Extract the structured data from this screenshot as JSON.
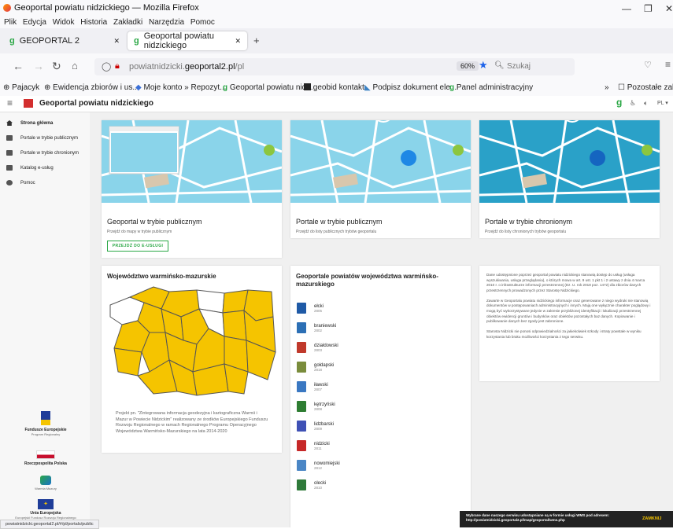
{
  "window": {
    "title": "Geoportal powiatu nidzickiego — Mozilla Firefox",
    "minimize": "—",
    "maximize": "❐",
    "close": "✕"
  },
  "menu": [
    "Plik",
    "Edycja",
    "Widok",
    "Historia",
    "Zakładki",
    "Narzędzia",
    "Pomoc"
  ],
  "tabs": [
    {
      "label": "GEOPORTAL 2",
      "close": "✕"
    },
    {
      "label": "Geoportal powiatu nidzickiego",
      "close": "✕"
    }
  ],
  "new_tab": "+",
  "url": {
    "prefix": "powiatnidzicki.",
    "domain": "geoportal2.pl",
    "path": "/pl"
  },
  "zoom": "60%",
  "search_placeholder": "Szukaj",
  "bookmarks": [
    "Pajacyk",
    "Ewidencja zbiorów i us...",
    "Moje konto » Repozyt...",
    "Geoportal powiatu nid...",
    "geobid kontakt",
    "Podpisz dokument ele...",
    "Panel administracyjny"
  ],
  "bookmarks_more": "»",
  "bookmarks_other": "Pozostałe zakładki",
  "app": {
    "title": "Geoportal powiatu nidzickiego",
    "lang": "PL"
  },
  "sidebar": [
    {
      "label": "Strona główna",
      "icon": "home-icon"
    },
    {
      "label": "Portale w trybie publicznym",
      "icon": "people-icon"
    },
    {
      "label": "Portale w trybie chronionym",
      "icon": "lock-icon"
    },
    {
      "label": "Katalog e-usług",
      "icon": "folder-icon"
    },
    {
      "label": "Pomoc",
      "icon": "help-icon"
    }
  ],
  "cards": [
    {
      "title": "Geoportal w trybie publicznym",
      "subtitle": "Przejdź do mapy w trybie publicznym",
      "button": "PRZEJDŹ DO E-USŁUGI"
    },
    {
      "title": "Portale w trybie publicznym",
      "subtitle": "Przejdź do listy publicznych trybów geoportalu"
    },
    {
      "title": "Portale w trybie chronionym",
      "subtitle": "Przejdź do listy chronionych trybów geoportalu"
    }
  ],
  "region": {
    "title": "Województwo warmińsko-mazurskie",
    "project_text": "Projekt pn. \"Zintegrowana informacja geodezyjna i kartograficzna Warmii i Mazur w Powiecie Nidzickim\" realizowany ze środków Europejskiego Funduszu Rozwoju Regionalnego w ramach Regionalnego Programu Operacyjnego Województwa Warmińsko-Mazurskiego na lata 2014-2020"
  },
  "counties": {
    "title": "Geoportale powiatów województwa warmińsko-mazurskiego",
    "items": [
      {
        "name": "ełcki",
        "code": "2805",
        "color": "#1f5aa6"
      },
      {
        "name": "braniewski",
        "code": "2802",
        "color": "#2c6fb5"
      },
      {
        "name": "działdowski",
        "code": "2803",
        "color": "#c0392b"
      },
      {
        "name": "gołdapski",
        "code": "2818",
        "color": "#7a8c3c"
      },
      {
        "name": "iławski",
        "code": "2807",
        "color": "#3a78c2"
      },
      {
        "name": "kętrzyński",
        "code": "2808",
        "color": "#2e7d32"
      },
      {
        "name": "lidzbarski",
        "code": "2809",
        "color": "#3f51b5"
      },
      {
        "name": "nidzicki",
        "code": "2811",
        "color": "#c62828"
      },
      {
        "name": "nowomiejski",
        "code": "2812",
        "color": "#4a86c5"
      },
      {
        "name": "olecki",
        "code": "2810",
        "color": "#2f7a3a"
      }
    ]
  },
  "disclaimer": [
    "Dane udostępnione poprzez geoportal powiatu nidzickiego stanowią dostęp do usług (usługa wyszukiwania, usługa przeglądania), o których mowa w art. 9 ust. 1 pkt 1 i 2 ustawy z dnia 4 marca 2010 r. o infrastrukturze informacji przestrzennej (Dz. U. rok 2018 poz. 1472) dla zbiorów danych przestrzennych prowadzonych przez Starostę Nidzickiego.",
    "Zawarte w Geoportalu powiatu nidzickiego informacje oraz generowane z niego wydruki nie stanowią dokumentów w postępowaniach administracyjnych i innych. Mają one wyłącznie charakter poglądowy i mogą być wykorzystywane jedynie w zakresie przybliżonej identyfikacji i lokalizacji przestrzennej obiektów ewidencji gruntów i budynków oraz obiektów pozostałych baz danych. Kopiowanie i publikowanie danych bez zgody jest zabronione.",
    "Starosta Nidzicki nie ponosi odpowiedzialności za jakiekolwiek szkody i straty powstałe w wyniku korzystania lub braku możliwości korzystania z tego serwisu."
  ],
  "footer_logos": [
    "Fundusze Europejskie",
    "Program Regionalny",
    "Rzeczpospolita Polska",
    "Warmia Mazury",
    "Unia Europejska",
    "Europejski Fundusz Rozwoju Regionalnego"
  ],
  "status_url": "powiatnidzicki.geoportal2.pl/#/pl/portals/public",
  "notice": {
    "text": "Wybrane dane naszego serwisu udostępniane są w formie usługi WMS pod adresem: http://powiatnidzicki.geoportal2.pl/map/geoportal/wms.php",
    "button": "ZAMKNIJ"
  }
}
